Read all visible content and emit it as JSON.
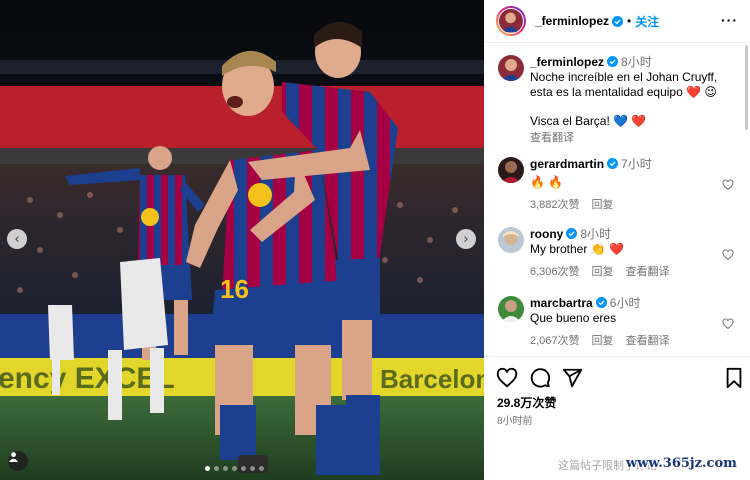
{
  "photo": {
    "description_icons": {
      "prev": "chevron-left-icon",
      "next": "chevron-right-icon",
      "tags": "person-tag-icon"
    },
    "carousel_total": 7,
    "carousel_active": 1,
    "banner_text_left": "ency EXCEL",
    "banner_text_right": "Barcelon",
    "jersey_number": "16"
  },
  "header": {
    "username": "_ferminlopez",
    "separator": "•",
    "follow_label": "关注",
    "more_label": "···"
  },
  "comments": [
    {
      "username": "_ferminlopez",
      "time": "8小时",
      "lines": [
        "Noche increíble en el Johan Cruyff,",
        "esta es la mentalidad equipo ❤️ 😉",
        "",
        "Visca el Barça! 💙 ❤️"
      ],
      "meta": [
        "查看翻译"
      ],
      "verified": true
    },
    {
      "username": "gerardmartin",
      "time": "7小时",
      "lines": [
        "🔥 🔥"
      ],
      "meta": [
        "3,882次赞",
        "回复"
      ],
      "verified": true
    },
    {
      "username": "roony",
      "time": "8小时",
      "lines": [
        "My brother 👏 ❤️"
      ],
      "meta": [
        "6,306次赞",
        "回复",
        "查看翻译"
      ],
      "verified": true
    },
    {
      "username": "marcbartra",
      "time": "6小时",
      "lines": [
        "Que bueno eres"
      ],
      "meta": [
        "2,067次赞",
        "回复",
        "查看翻译"
      ],
      "verified": true
    }
  ],
  "actions": {
    "icons": [
      "heart-icon",
      "comment-icon",
      "share-icon",
      "bookmark-icon"
    ],
    "likes": "29.8万次赞",
    "time": "8小时前"
  },
  "footer": {
    "disabled_note": "这篇帖子限制了评论",
    "watermark": "www.365jz.com"
  },
  "colors": {
    "link": "#0095f6",
    "muted": "#737373",
    "verified": "#0095f6",
    "barca_blue": "#1d3f8f",
    "barca_red": "#a50044"
  }
}
